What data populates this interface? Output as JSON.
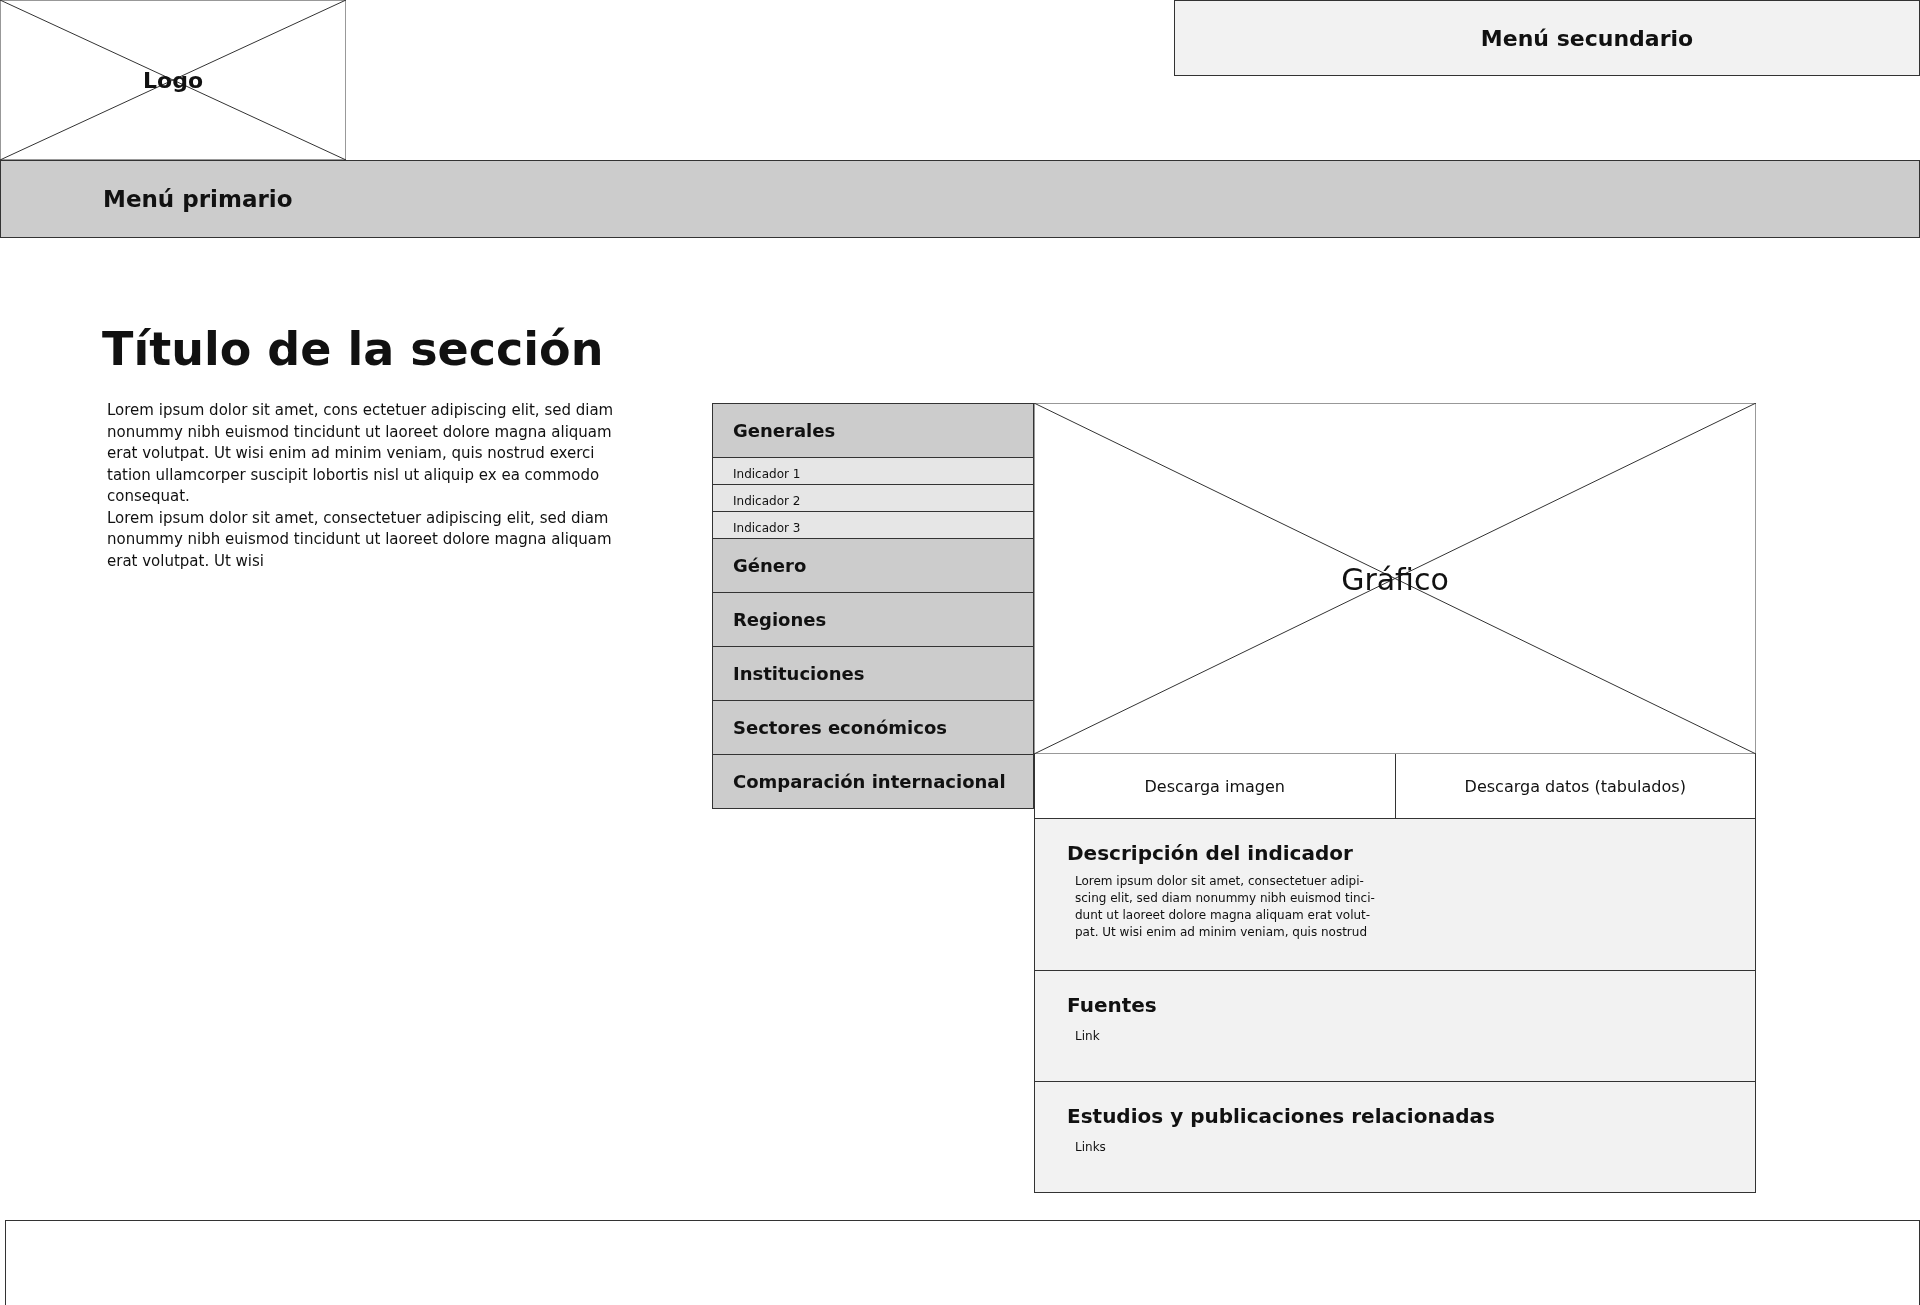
{
  "header": {
    "logo": "Logo",
    "secondary_menu": "Menú secundario",
    "primary_menu": "Menú primario"
  },
  "section_title": "Título de la sección",
  "intro_paragraphs": [
    {
      "lines": [
        "Lorem ipsum dolor sit amet, cons ectetuer adipiscing elit, sed diam",
        "nonummy nibh euismod tincidunt ut laoreet dolore magna aliquam",
        "erat volutpat. Ut wisi enim ad minim veniam, quis nostrud exerci",
        "tation ullamcorper suscipit lobortis nisl ut aliquip ex ea commodo",
        "consequat."
      ]
    },
    {
      "lines": [
        "Lorem ipsum dolor sit amet, consectetuer adipiscing elit, sed diam",
        "nonummy nibh euismod tincidunt ut laoreet dolore magna aliquam",
        "erat volutpat. Ut wisi"
      ]
    }
  ],
  "sidebar": {
    "items": [
      {
        "label": "Generales",
        "children": [
          {
            "label": "Indicador 1"
          },
          {
            "label": "Indicador 2"
          },
          {
            "label": "Indicador 3"
          }
        ]
      },
      {
        "label": "Género"
      },
      {
        "label": "Regiones"
      },
      {
        "label": "Instituciones"
      },
      {
        "label": "Sectores económicos"
      },
      {
        "label": "Comparación internacional"
      }
    ]
  },
  "chart_placeholder": {
    "label": "Gráfico"
  },
  "downloads": [
    "Descarga imagen",
    "Descarga datos (tabulados)"
  ],
  "info_panels": [
    {
      "title": "Descripción del indicador",
      "kind": "text",
      "lines": [
        "Lorem ipsum dolor sit amet, consectetuer adipi-",
        "scing elit, sed diam nonummy nibh euismod tinci-",
        "dunt ut laoreet dolore magna aliquam erat volut-",
        "pat. Ut wisi enim ad minim veniam, quis nostrud"
      ]
    },
    {
      "title": "Fuentes",
      "kind": "link",
      "lines": [
        "Link"
      ]
    },
    {
      "title": "Estudios y publicaciones relacionadas",
      "kind": "link",
      "lines": [
        "Links"
      ]
    }
  ]
}
